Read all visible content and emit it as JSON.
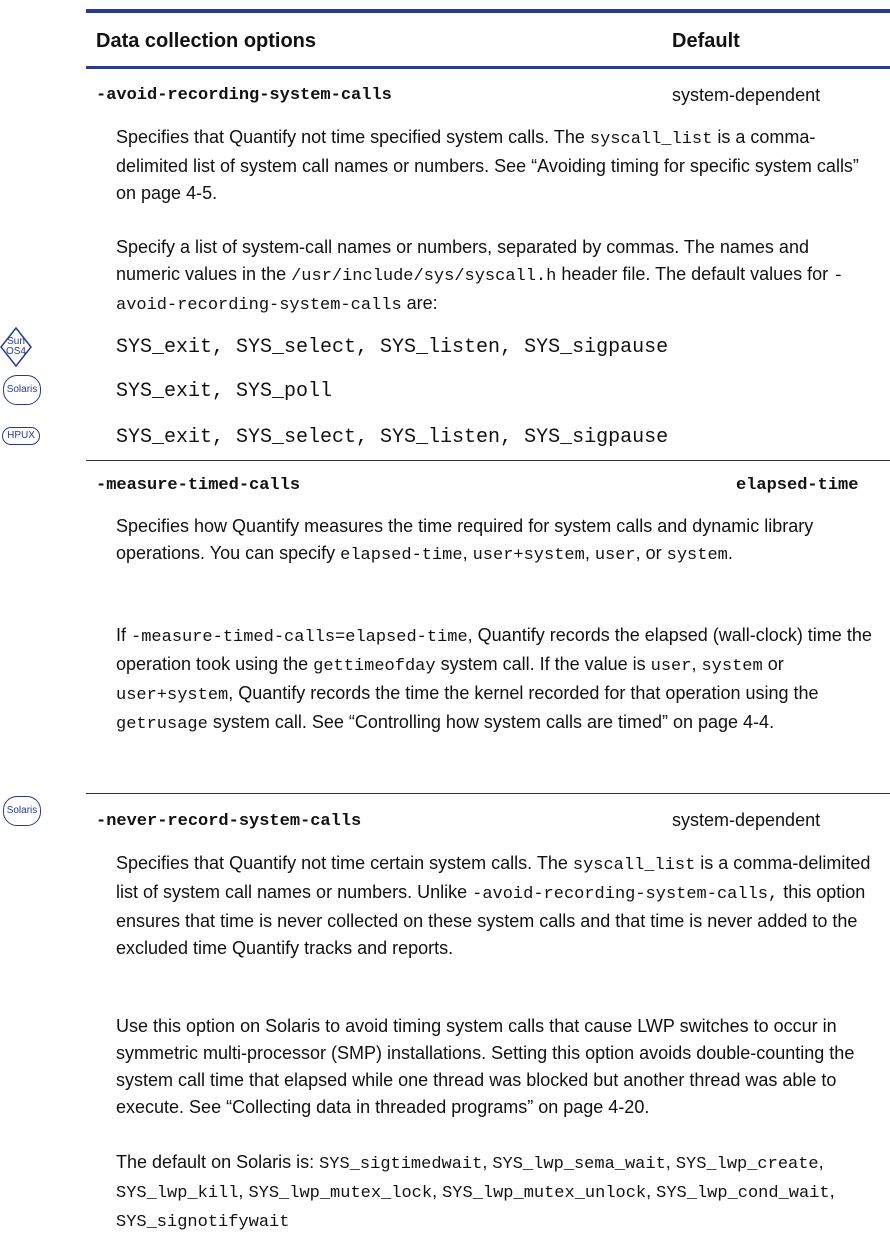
{
  "table_header": {
    "col1": "Data collection options",
    "col2": "Default"
  },
  "badges": {
    "sunos4": "Sun OS4",
    "solaris": "Solaris",
    "hpux": "HPUX"
  },
  "opt1": {
    "name": "-avoid-recording-system-calls",
    "default": "system-dependent",
    "p1": [
      "Specifies that Quantify not time specified system calls. The ",
      "syscall_list",
      " is a comma-delimited list of system call names or numbers. See “Avoiding timing for specific system calls” on page 4-5."
    ],
    "p2": [
      "Specify a list of system-call names or numbers, separated by commas. The names and numeric values in the ",
      "/usr/include/sys/syscall.h",
      " header file. The default values for ",
      "-avoid-recording-system-calls",
      " are:"
    ],
    "sunos4_values": "SYS_exit, SYS_select, SYS_listen, SYS_sigpause",
    "solaris_values": "SYS_exit, SYS_poll",
    "hpux_values": "SYS_exit, SYS_select, SYS_listen, SYS_sigpause"
  },
  "opt2": {
    "name": "-measure-timed-calls",
    "default": "elapsed-time",
    "p1": [
      "Specifies how Quantify measures the time required for system calls and dynamic library operations. You can specify ",
      "elapsed-time",
      ", ",
      "user+system",
      ", ",
      "user",
      ", or ",
      "system",
      "."
    ],
    "p2": [
      "If ",
      "-measure-timed-calls=elapsed-time",
      ", Quantify records the elapsed (wall-clock) time the operation took using the ",
      "gettimeofday",
      " system call. If the value is ",
      "user",
      ", ",
      "system",
      " or ",
      "user+system",
      ", Quantify records the time the kernel recorded for that operation using the ",
      "getrusage",
      " system call. See “Controlling how system calls are timed” on page 4-4."
    ]
  },
  "opt3": {
    "name": "-never-record-system-calls",
    "default": "system-dependent",
    "p1": [
      "Specifies that Quantify not time certain system calls. The ",
      "syscall_list",
      " is a comma-delimited list of system call names or numbers. Unlike ",
      "-avoid-recording-system-calls,",
      " this option ensures that time is never collected on these system calls and that time is never added to the excluded time Quantify tracks and reports."
    ],
    "p2": "Use this option on Solaris to avoid timing system calls that cause LWP switches to occur in symmetric multi-processor (SMP) installations. Setting this option avoids double-counting the system call time that elapsed while one thread was blocked but another thread was able to execute. See “Collecting data in threaded programs” on page 4-20.",
    "p3": [
      "The default on Solaris is: ",
      "SYS_sigtimedwait",
      ", ",
      "SYS_lwp_sema_wait",
      ", ",
      "SYS_lwp_create",
      ", ",
      "SYS_lwp_kill",
      ", ",
      "SYS_lwp_mutex_lock",
      ", ",
      "SYS_lwp_mutex_unlock",
      ", ",
      "SYS_lwp_cond_wait",
      ", ",
      "SYS_signotifywait"
    ]
  }
}
